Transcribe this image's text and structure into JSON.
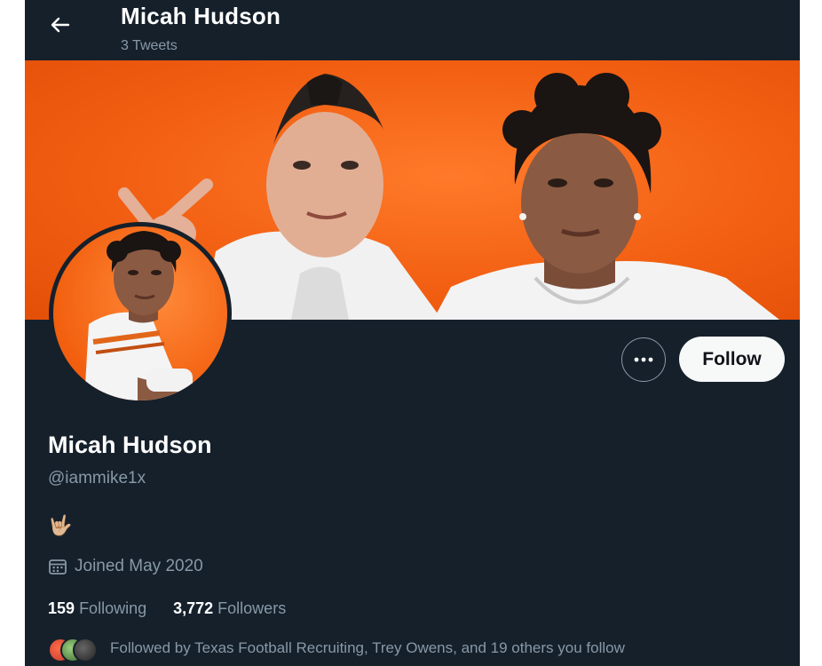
{
  "header": {
    "name": "Micah Hudson",
    "tweet_count": "3 Tweets"
  },
  "profile": {
    "name": "Micah Hudson",
    "handle": "@iammike1x",
    "bio_emoji": "🤟🏼",
    "joined": "Joined May 2020",
    "following_count": "159",
    "following_label": "Following",
    "followers_count": "3,772",
    "followers_label": "Followers",
    "followed_by": "Followed by Texas Football Recruiting, Trey Owens, and 19 others you follow"
  },
  "actions": {
    "more_label": "•••",
    "follow_label": "Follow"
  },
  "colors": {
    "background": "#15202b",
    "banner_orange": "#f25f12",
    "secondary_text": "#8899a6",
    "follow_button": "#f7f9f9"
  },
  "icons": {
    "back": "arrow-left-icon",
    "more": "more-dots-icon",
    "calendar": "calendar-icon"
  }
}
